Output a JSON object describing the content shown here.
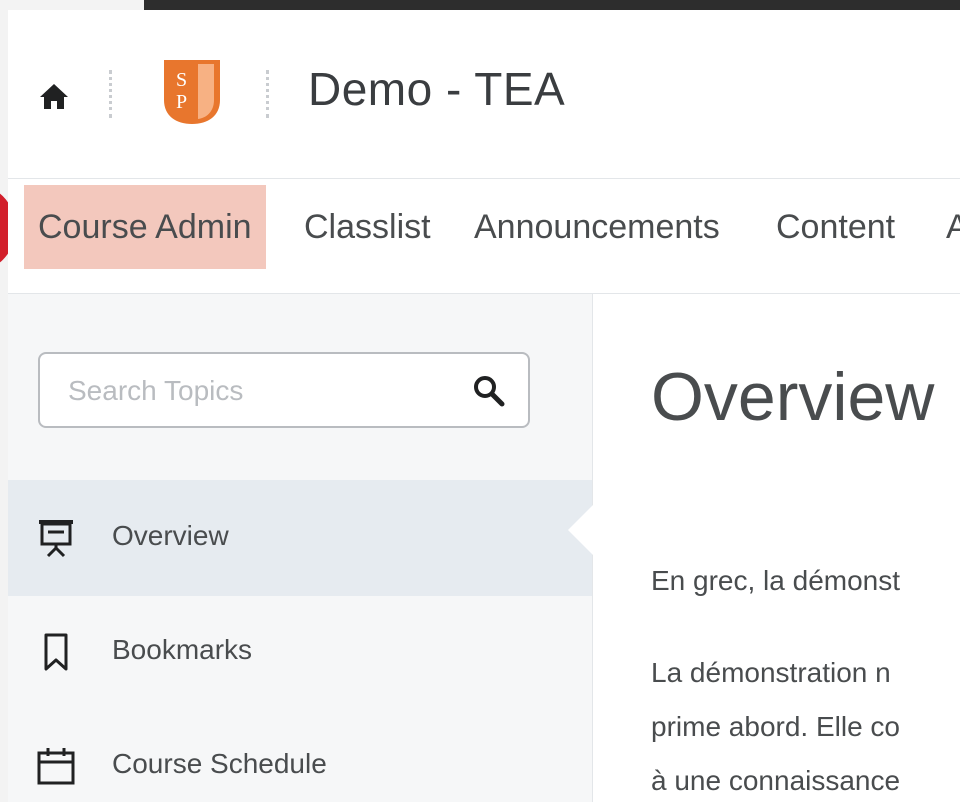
{
  "header": {
    "course_title": "Demo - TEA",
    "logo_text_top": "S",
    "logo_text_bottom": "P",
    "logo_color": "#e8762d"
  },
  "nav": {
    "items": [
      "Course Admin",
      "Classlist",
      "Announcements",
      "Content",
      "A"
    ],
    "highlight_color": "#f3c8bd",
    "marker_color": "#d21f2b"
  },
  "sidebar": {
    "search_placeholder": "Search Topics",
    "topics": [
      {
        "label": "Overview",
        "icon": "presentation-board-icon",
        "active": true
      },
      {
        "label": "Bookmarks",
        "icon": "bookmark-icon",
        "active": false
      },
      {
        "label": "Course Schedule",
        "icon": "calendar-icon",
        "active": false
      }
    ]
  },
  "main": {
    "title": "Overview",
    "para1_line1": "En grec, la démonst",
    "para2_line1": "La démonstration n",
    "para2_line2": "prime abord. Elle co",
    "para2_line3": "à une connaissance"
  }
}
